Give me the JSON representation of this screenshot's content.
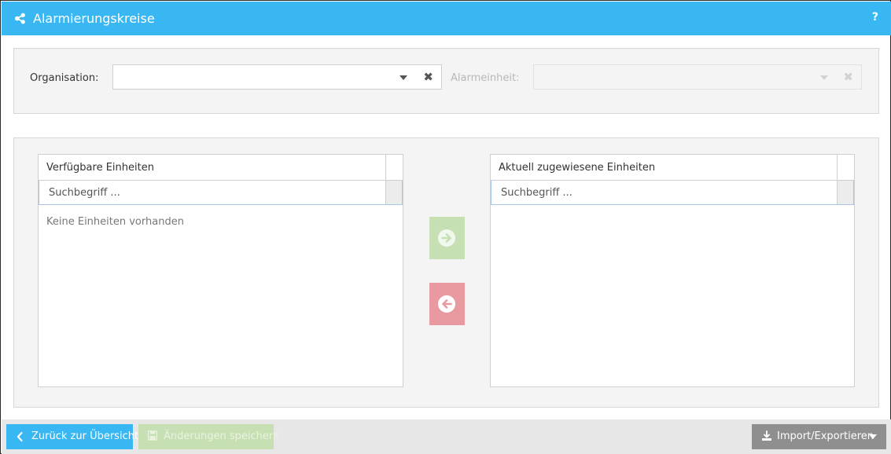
{
  "header": {
    "title": "Alarmierungskreise",
    "help": "?",
    "color": "#38b7f3"
  },
  "filters": {
    "organisation_label": "Organisation:",
    "organisation_value": "",
    "unit_label": "Alarmeinheit:",
    "unit_value": "",
    "clear_glyph": "✖"
  },
  "available": {
    "title": "Verfügbare Einheiten",
    "search_placeholder": "Suchbegriff ...",
    "empty_message": "Keine Einheiten vorhanden"
  },
  "assigned": {
    "title": "Aktuell zugewiesene Einheiten",
    "search_placeholder": "Suchbegriff ..."
  },
  "footer": {
    "back_label": "Zurück zur Übersicht",
    "save_label": "Änderungen speichern",
    "import_label": "Import/Exportieren"
  },
  "icons": {
    "header": "share-icon",
    "help": "question-icon",
    "move_right": "arrow-circle-right-icon",
    "move_left": "arrow-circle-left-icon",
    "back": "chevron-left-icon",
    "save": "floppy-disk-icon",
    "import": "download-icon"
  },
  "colors": {
    "move_right": "#c6e0b4",
    "move_left": "#e89aa0",
    "import_button": "#8f8f8f"
  }
}
